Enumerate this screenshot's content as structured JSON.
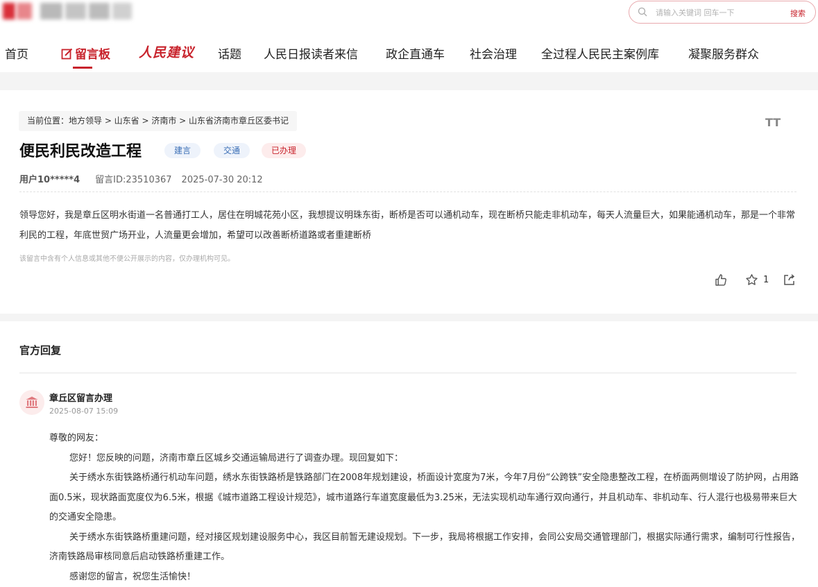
{
  "header": {
    "search_placeholder": "请输入关键词 回车一下",
    "search_button": "搜索"
  },
  "nav": {
    "items": [
      "首页",
      "留言板",
      "人民建议",
      "话题",
      "人民日报读者来信",
      "政企直通车",
      "社会治理",
      "全过程人民民主案例库",
      "凝聚服务群众"
    ],
    "active_index": 1
  },
  "breadcrumb": "当前位置：地方领导 > 山东省 > 济南市 > 山东省济南市章丘区委书记",
  "font_size_toggle": "TT",
  "message": {
    "title": "便民利民改造工程",
    "tags": [
      "建言",
      "交通",
      "已办理"
    ],
    "user": "用户10*****4",
    "message_id": "留言ID:23510367",
    "datetime": "2025-07-30 20:12",
    "body": "领导您好，我是章丘区明水街道一名普通打工人，居住在明城花苑小区，我想提议明珠东街，断桥是否可以通机动车，现在断桥只能走非机动车，每天人流量巨大，如果能通机动车，那是一个非常利民的工程，年底世贸广场开业，人流量更会增加，希望可以改善断桥道路或者重建断桥",
    "privacy_note": "该留言中含有个人信息或其他不便公开展示的内容，仅办理机构可见。",
    "favorite_count": "1"
  },
  "reply": {
    "heading": "官方回复",
    "org": "章丘区留言办理",
    "date": "2025-08-07 15:09",
    "greeting": "尊敬的网友：",
    "paragraphs": [
      "您好！您反映的问题，济南市章丘区城乡交通运输局进行了调查办理。现回复如下：",
      "关于绣水东街铁路桥通行机动车问题，绣水东街铁路桥是铁路部门在2008年规划建设，桥面设计宽度为7米，今年7月份“公跨铁”安全隐患整改工程，在桥面两侧增设了防护网，占用路面0.5米，现状路面宽度仅为6.5米，根据《城市道路工程设计规范》，城市道路行车道宽度最低为3.25米，无法实现机动车通行双向通行，并且机动车、非机动车、行人混行也极易带来巨大的交通安全隐患。",
      "关于绣水东街铁路桥重建问题，经对接区规划建设服务中心，我区目前暂无建设规划。下一步，我局将根据工作安排，会同公安局交通管理部门，根据实际通行需求，编制可行性报告，济南铁路局审核同意后启动铁路桥重建工作。",
      "感谢您的留言，祝您生活愉快！"
    ]
  },
  "colors": {
    "brand_red": "#c8232c",
    "tag_blue": "#3b6fb6"
  }
}
